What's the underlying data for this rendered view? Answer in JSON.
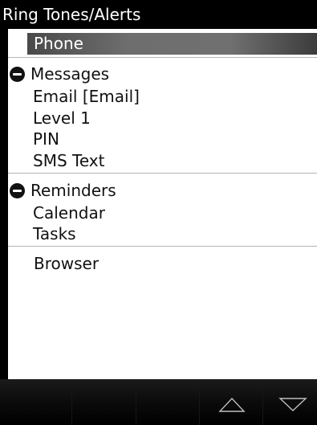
{
  "title": "Ring Tones/Alerts",
  "list": {
    "selected_item": "Phone",
    "groups": [
      {
        "label": "Messages",
        "expanded": true,
        "items": [
          "Email [Email]",
          "Level 1",
          "PIN",
          "SMS Text"
        ]
      },
      {
        "label": "Reminders",
        "expanded": true,
        "items": [
          "Calendar",
          "Tasks"
        ]
      }
    ],
    "last_item": "Browser"
  },
  "bottom_bar": {
    "up_icon": "triangle-up-icon",
    "down_icon": "triangle-down-icon"
  },
  "colors": {
    "background": "#000000",
    "list_background": "#ffffff",
    "selection": "#6e6e6e",
    "divider": "#b4b4b4"
  }
}
